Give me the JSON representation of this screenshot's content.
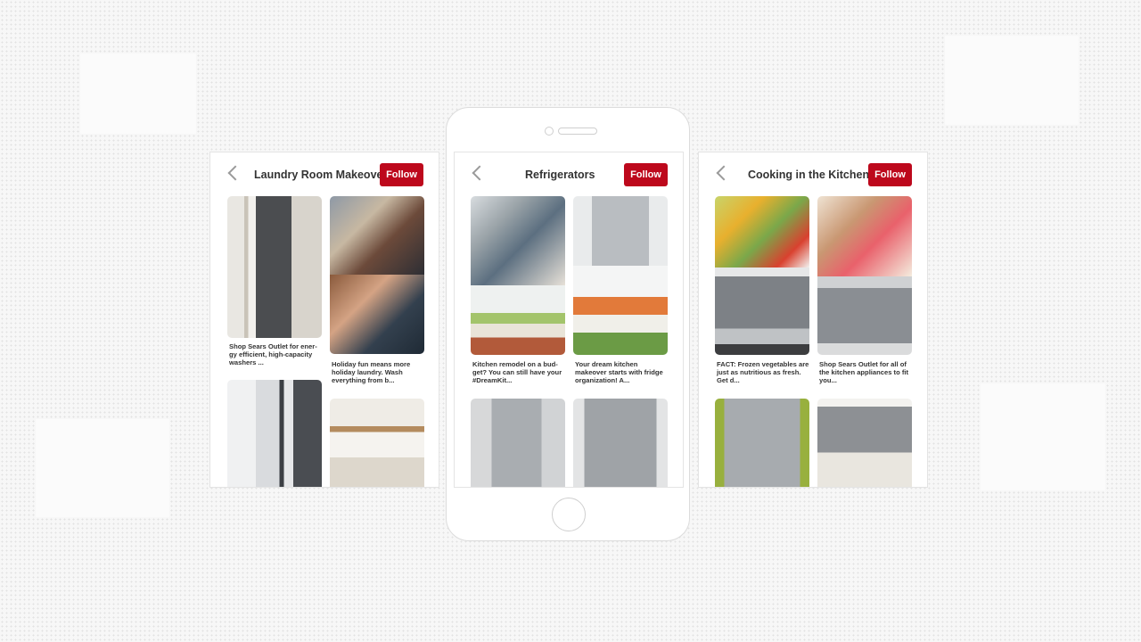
{
  "colors": {
    "accent": "#bd081c"
  },
  "boards": [
    {
      "title": "Laundry Room Makeover",
      "follow_label": "Follow",
      "pins": [
        {
          "caption": "Shop Sears Outlet for ener-gy efficient, high-capacity washers ..."
        },
        {
          "caption": "Holiday fun means more holiday laundry. Wash everything from b..."
        }
      ]
    },
    {
      "title": "Refrigerators",
      "follow_label": "Follow",
      "pins": [
        {
          "caption": "Kitchen remodel on a bud-get? You can still have your #DreamKit..."
        },
        {
          "caption": "Your dream kitchen makeover starts with fridge organization! A..."
        }
      ]
    },
    {
      "title": "Cooking in the Kitchen",
      "follow_label": "Follow",
      "pins": [
        {
          "caption": "FACT: Frozen vegetables are just as nutritious as fresh. Get d..."
        },
        {
          "caption": "Shop Sears Outlet for all of the kitchen appliances to fit you..."
        }
      ]
    }
  ]
}
